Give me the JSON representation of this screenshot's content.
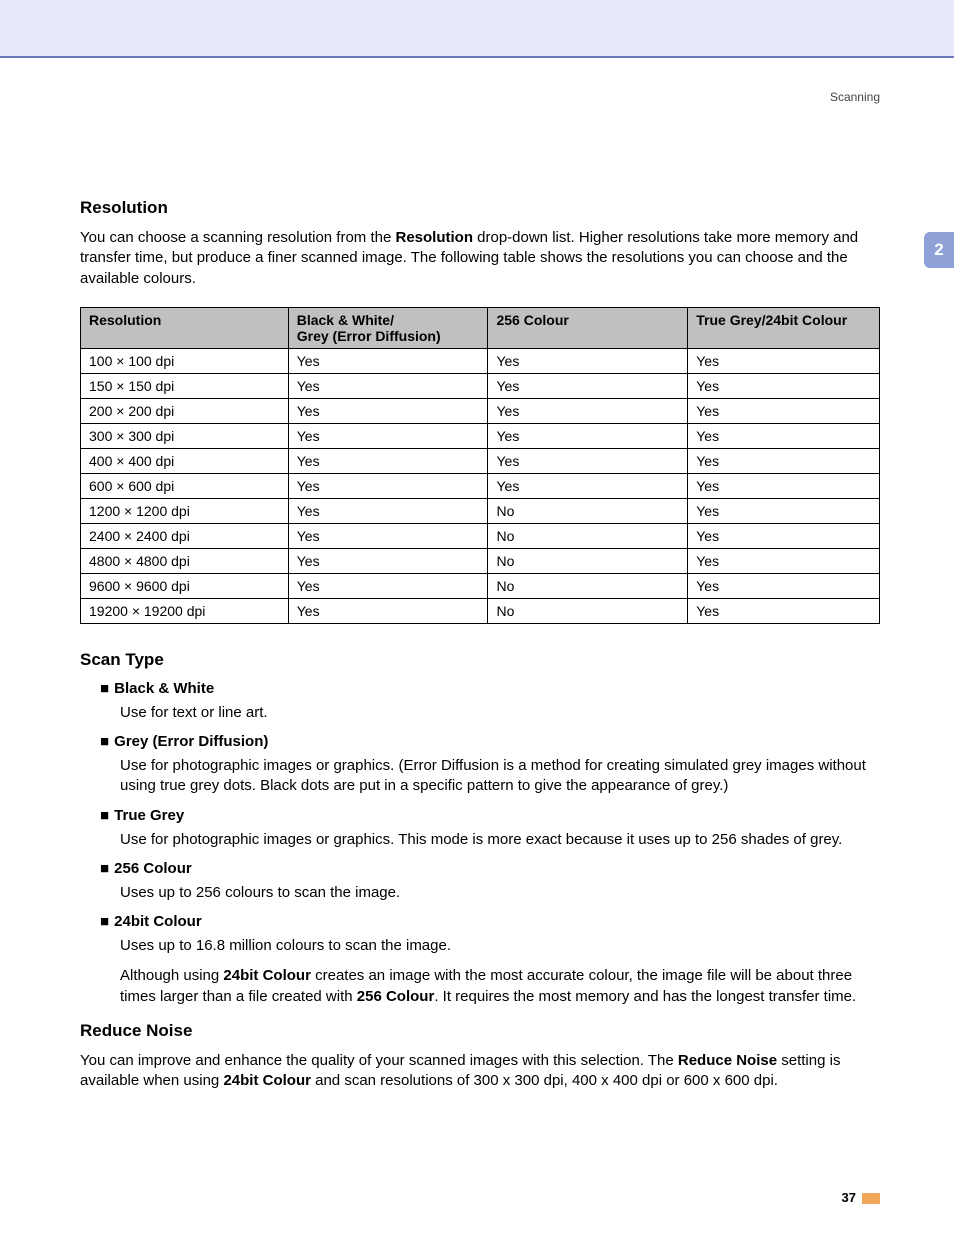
{
  "header": {
    "breadcrumb": "Scanning"
  },
  "side_tab": "2",
  "footer": {
    "page_number": "37"
  },
  "resolution": {
    "heading": "Resolution",
    "intro_parts": {
      "a": "You can choose a scanning resolution from the ",
      "b": "Resolution",
      "c": " drop-down list. Higher resolutions take more memory and transfer time, but produce a finer scanned image. The following table shows the resolutions you can choose and the available colours."
    },
    "table": {
      "headers": {
        "res": "Resolution",
        "bw": "Black & White/\nGrey (Error Diffusion)",
        "c256": "256 Colour",
        "truec": "True Grey/24bit Colour"
      },
      "rows": [
        {
          "res": "100 × 100 dpi",
          "bw": "Yes",
          "c256": "Yes",
          "truec": "Yes"
        },
        {
          "res": "150 × 150 dpi",
          "bw": "Yes",
          "c256": "Yes",
          "truec": "Yes"
        },
        {
          "res": "200 × 200 dpi",
          "bw": "Yes",
          "c256": "Yes",
          "truec": "Yes"
        },
        {
          "res": "300 × 300 dpi",
          "bw": "Yes",
          "c256": "Yes",
          "truec": "Yes"
        },
        {
          "res": "400 × 400 dpi",
          "bw": "Yes",
          "c256": "Yes",
          "truec": "Yes"
        },
        {
          "res": "600 × 600 dpi",
          "bw": "Yes",
          "c256": "Yes",
          "truec": "Yes"
        },
        {
          "res": "1200 × 1200 dpi",
          "bw": "Yes",
          "c256": "No",
          "truec": "Yes"
        },
        {
          "res": "2400 × 2400 dpi",
          "bw": "Yes",
          "c256": "No",
          "truec": "Yes"
        },
        {
          "res": "4800 × 4800 dpi",
          "bw": "Yes",
          "c256": "No",
          "truec": "Yes"
        },
        {
          "res": "9600 × 9600 dpi",
          "bw": "Yes",
          "c256": "No",
          "truec": "Yes"
        },
        {
          "res": "19200 × 19200 dpi",
          "bw": "Yes",
          "c256": "No",
          "truec": "Yes"
        }
      ]
    }
  },
  "scan_type": {
    "heading": "Scan Type",
    "items": [
      {
        "title": "Black & White",
        "desc": "Use for text or line art."
      },
      {
        "title": "Grey (Error Diffusion)",
        "desc": "Use for photographic images or graphics. (Error Diffusion is a method for creating simulated grey images without using true grey dots. Black dots are put in a specific pattern to give the appearance of grey.)"
      },
      {
        "title": "True Grey",
        "desc": "Use for photographic images or graphics. This mode is more exact because it uses up to 256 shades of grey."
      },
      {
        "title": "256 Colour",
        "desc": "Uses up to 256 colours to scan the image."
      },
      {
        "title": "24bit Colour",
        "desc": "Uses up to 16.8 million colours to scan the image.",
        "desc2_parts": {
          "a": "Although using ",
          "b": "24bit Colour",
          "c": " creates an image with the most accurate colour, the image file will be about three times larger than a file created with ",
          "d": "256 Colour",
          "e": ". It requires the most memory and has the longest transfer time."
        }
      }
    ]
  },
  "reduce_noise": {
    "heading": "Reduce Noise",
    "intro_parts": {
      "a": "You can improve and enhance the quality of your scanned images with this selection.  The ",
      "b": "Reduce Noise",
      "c": " setting is available when using ",
      "d": "24bit Colour",
      "e": " and scan resolutions of 300 x 300 dpi, 400 x 400 dpi or 600 x 600 dpi."
    }
  }
}
